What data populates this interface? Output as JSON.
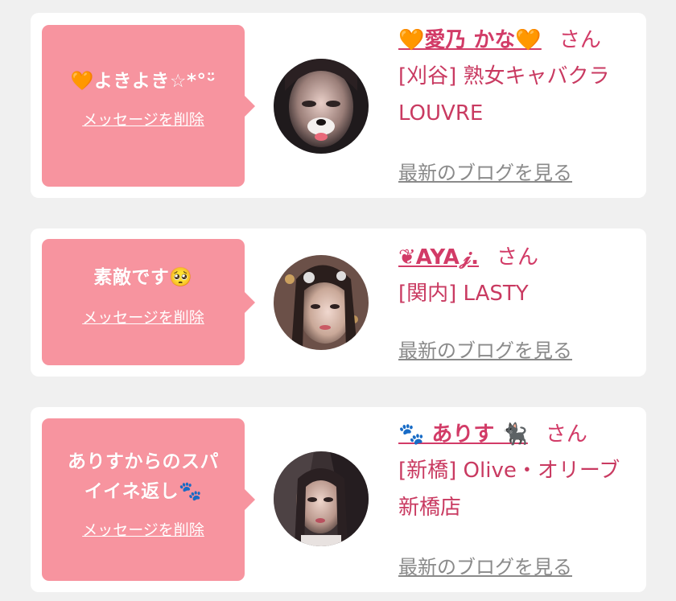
{
  "messages": [
    {
      "bubble_lines": [
        "🧡よきよき☆*°ᵕ̈"
      ],
      "delete_label": "メッセージを削除",
      "name": "🧡愛乃 かな🧡",
      "suffix": "さん",
      "shop_lines": [
        "[刈谷] 熟女キャバクラ",
        "LOUVRE"
      ],
      "blog_label": "最新のブログを見る"
    },
    {
      "bubble_lines": [
        "素敵です🥺"
      ],
      "delete_label": "メッセージを削除",
      "name": "❦AYA𝒿.",
      "suffix": "さん",
      "shop_lines": [
        "[関内] LASTY"
      ],
      "blog_label": "最新のブログを見る"
    },
    {
      "bubble_lines": [
        "ありすからのスパ",
        "イイネ返し🐾"
      ],
      "delete_label": "メッセージを削除",
      "name": "🐾 ありす 🐈‍⬛",
      "suffix": "さん",
      "shop_lines": [
        "[新橋] Olive・オリーブ",
        "新橋店"
      ],
      "blog_label": "最新のブログを見る"
    }
  ],
  "colors": {
    "bubble": "#f7949f",
    "name": "#d23b67",
    "blog_link": "#8a8a8a",
    "background": "#f0f0f0",
    "card": "#ffffff"
  },
  "icons": [
    "user-avatar-photo"
  ]
}
